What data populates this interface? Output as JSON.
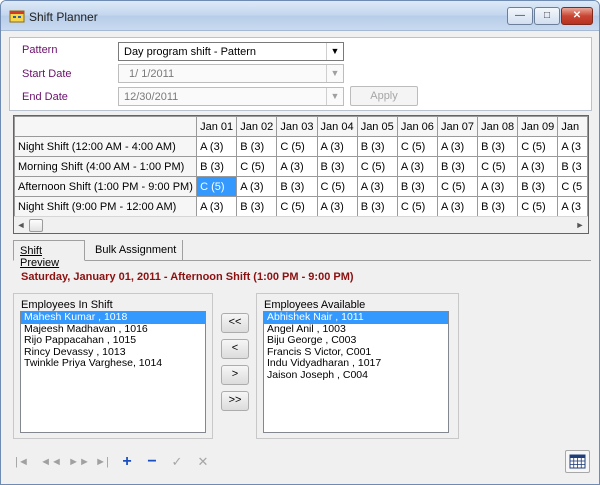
{
  "window": {
    "title": "Shift Planner",
    "controls": {
      "minimize": "—",
      "maximize": "□",
      "close": "✕"
    }
  },
  "form": {
    "pattern_label": "Pattern",
    "pattern_value": "Day program shift - Pattern",
    "start_date_label": "Start Date",
    "start_date_value": "1/  1/2011",
    "end_date_label": "End Date",
    "end_date_value": "12/30/2011",
    "apply_label": "Apply"
  },
  "grid": {
    "columns": [
      "Jan 01",
      "Jan 02",
      "Jan 03",
      "Jan 04",
      "Jan 05",
      "Jan 06",
      "Jan 07",
      "Jan 08",
      "Jan 09",
      "Jan"
    ],
    "rows": [
      {
        "label": "Night Shift (12:00 AM - 4:00 AM)",
        "cells": [
          "A (3)",
          "B (3)",
          "C (5)",
          "A (3)",
          "B (3)",
          "C (5)",
          "A (3)",
          "B (3)",
          "C (5)",
          "A (3"
        ]
      },
      {
        "label": "Morning Shift (4:00 AM - 1:00 PM)",
        "cells": [
          "B (3)",
          "C (5)",
          "A (3)",
          "B (3)",
          "C (5)",
          "A (3)",
          "B (3)",
          "C (5)",
          "A (3)",
          "B (3"
        ]
      },
      {
        "label": "Afternoon Shift (1:00 PM - 9:00 PM)",
        "cells": [
          "C (5)",
          "A (3)",
          "B (3)",
          "C (5)",
          "A (3)",
          "B (3)",
          "C (5)",
          "A (3)",
          "B (3)",
          "C (5"
        ]
      },
      {
        "label": "Night Shift (9:00 PM - 12:00 AM)",
        "cells": [
          "A (3)",
          "B (3)",
          "C (5)",
          "A (3)",
          "B (3)",
          "C (5)",
          "A (3)",
          "B (3)",
          "C (5)",
          "A (3"
        ]
      }
    ],
    "selected_cell": {
      "row": 2,
      "col": 0
    },
    "scroll_left": "◄",
    "scroll_right": "►"
  },
  "tabs": [
    {
      "label": "Shift Preview",
      "active": true
    },
    {
      "label": "Bulk Assignment",
      "active": false
    }
  ],
  "preview": {
    "heading": "Saturday, January 01, 2011  - Afternoon Shift (1:00 PM - 9:00 PM)",
    "in_shift_title": "Employees In Shift",
    "in_shift": [
      "Mahesh Kumar , 1018",
      "Majeesh Madhavan , 1016",
      "Rijo Pappacahan , 1015",
      "Rincy Devassy , 1013",
      "Twinkle Priya Varghese, 1014"
    ],
    "available_title": "Employees Available",
    "available": [
      "Abhishek  Nair , 1011",
      "Angel Anil , 1003",
      "Biju George , C003",
      "Francis S  Victor, C001",
      "Indu Vidyadharan , 1017",
      "Jaison Joseph , C004"
    ],
    "buttons": {
      "add_all": "<<",
      "add": "<",
      "remove": ">",
      "remove_all": ">>"
    }
  },
  "navigator": {
    "first": "|◄",
    "prev": "◄◄",
    "next": "►►",
    "last": "►|",
    "add": "+",
    "delete": "−",
    "save": "✓",
    "cancel": "✕"
  },
  "colors": {
    "label_purple": "#6b0f6b",
    "heading_red": "#8b1010",
    "selection_blue": "#3399ff",
    "nav_blue": "#1b4fbf"
  }
}
